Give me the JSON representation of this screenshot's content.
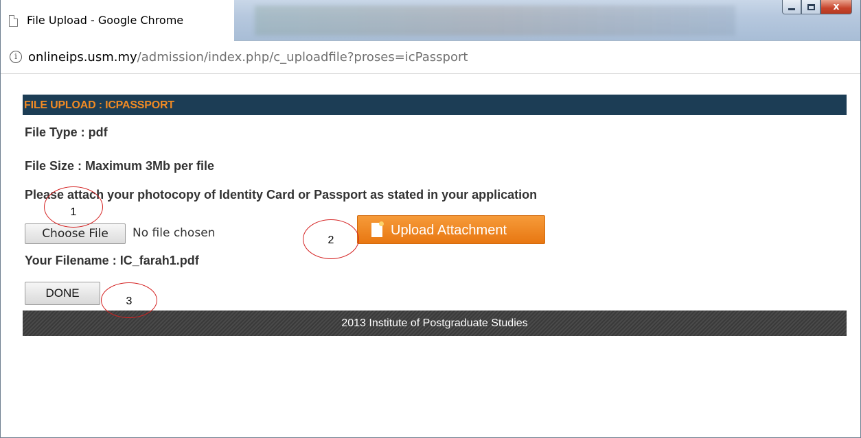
{
  "window": {
    "tab_title": "File Upload - Google Chrome",
    "controls": {
      "close": "x"
    }
  },
  "address": {
    "host": "onlineips.usm.my",
    "path": "/admission/index.php/c_uploadfile?proses=icPassport"
  },
  "page": {
    "header": "FILE UPLOAD : ICPASSPORT",
    "file_type": "File Type : pdf",
    "file_size": "File Size : Maximum 3Mb per file",
    "instruction": "Please attach your photocopy of Identity Card or Passport as stated in your application",
    "choose_file_label": "Choose File",
    "no_file_text": "No file chosen",
    "upload_label": "Upload Attachment",
    "filename": "Your Filename : IC_farah1.pdf",
    "done_label": "DONE",
    "footer": "2013 Institute of Postgraduate Studies"
  },
  "annotations": [
    "1",
    "2",
    "3"
  ],
  "colors": {
    "header_bg": "#1c3d55",
    "header_text": "#f08a24",
    "upload_button": "#e87712",
    "annotation": "#d42020"
  }
}
